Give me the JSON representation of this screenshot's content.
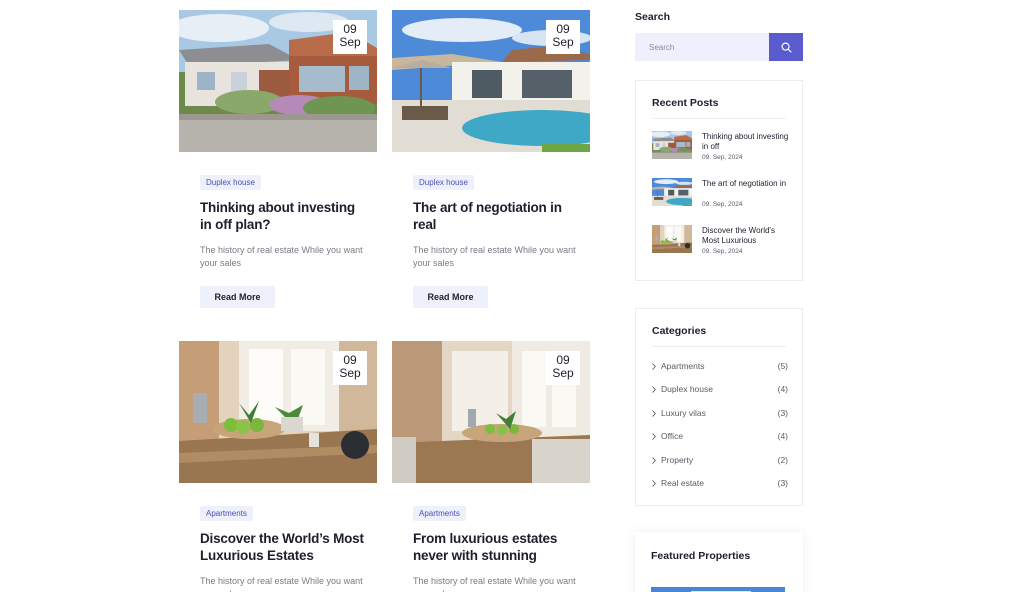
{
  "posts": [
    {
      "day": "09",
      "month": "Sep",
      "tag": "Duplex house",
      "title": "Thinking about investing in off plan?",
      "excerpt": "The history of real estate While you want your sales",
      "button": "Read More",
      "image": "house-exterior"
    },
    {
      "day": "09",
      "month": "Sep",
      "tag": "Duplex house",
      "title": "The art of negotiation in real",
      "excerpt": "The history of real estate While you want your sales",
      "button": "Read More",
      "image": "pool-villa"
    },
    {
      "day": "09",
      "month": "Sep",
      "tag": "Apartments",
      "title": "Discover the World’s Most Luxurious Estates",
      "excerpt": "The history of real estate While you want your sales",
      "image": "dining-table"
    },
    {
      "day": "09",
      "month": "Sep",
      "tag": "Apartments",
      "title": "From luxurious estates never with stunning",
      "excerpt": "The history of real estate While you want your sales",
      "image": "dining-room"
    }
  ],
  "sidebar": {
    "search": {
      "label": "Search",
      "placeholder": "Search",
      "icon": "search-icon"
    },
    "recent": {
      "title": "Recent Posts",
      "items": [
        {
          "title": "Thinking about investing in off",
          "date": "09. Sep, 2024"
        },
        {
          "title": "The art of negotiation in",
          "date": "09. Sep, 2024"
        },
        {
          "title": "Discover the World's Most Luxurious",
          "date": "09. Sep, 2024"
        }
      ]
    },
    "categories": {
      "title": "Categories",
      "items": [
        {
          "name": "Apartments",
          "count": "(5)"
        },
        {
          "name": "Duplex house",
          "count": "(4)"
        },
        {
          "name": "Luxury vilas",
          "count": "(3)"
        },
        {
          "name": "Office",
          "count": "(4)"
        },
        {
          "name": "Property",
          "count": "(2)"
        },
        {
          "name": "Real estate",
          "count": "(3)"
        }
      ]
    },
    "featured": {
      "title": "Featured Properties"
    }
  },
  "colors": {
    "accent": "#5a5bcf",
    "tag_bg": "#eef0fb",
    "tag_text": "#4d4fb5",
    "button_bg": "#eef1fb"
  }
}
